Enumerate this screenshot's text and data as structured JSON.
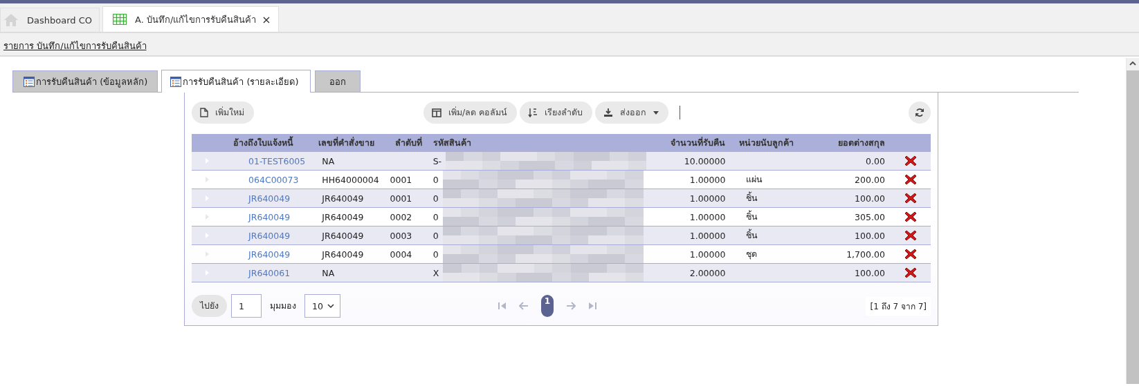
{
  "document_tabs": [
    {
      "label": "Dashboard CO",
      "selected": false,
      "kind": "home"
    },
    {
      "label": "A. บันทึก/แก้ไขการรับคืนสินค้า",
      "selected": true,
      "kind": "grid",
      "close": "×"
    }
  ],
  "breadcrumb": "รายการ บันทึก/แก้ไขการรับคืนสินค้า",
  "page_tabs": [
    {
      "label": "การรับคืนสินค้า (ข้อมูลหลัก)",
      "selected": false,
      "kind": "icon"
    },
    {
      "label": "การรับคืนสินค้า (รายละเอียด)",
      "selected": true,
      "kind": "icon"
    },
    {
      "label": "ออก",
      "selected": false,
      "kind": "plain"
    }
  ],
  "toolbar": {
    "add": "เพิ่มใหม่",
    "columns": "เพิ่ม/ลด คอลัมน์",
    "sort": "เรียงลำดับ",
    "export": "ส่งออก"
  },
  "table": {
    "columns": [
      "อ้างถึงใบแจ้งหนี้",
      "เลขที่คำสั่งขาย",
      "ลำดับที่",
      "รหัสสินค้า",
      "จำนวนที่รับคืน",
      "หน่วยนับลูกค้า",
      "ยอดต่างสกุล"
    ],
    "rows": [
      {
        "ref": "01-TEST6005",
        "order": "NA",
        "seq": "",
        "code": "S-",
        "qty": "10.00000",
        "unit": "",
        "amount": "0.00"
      },
      {
        "ref": "064C00073",
        "order": "HH64000004",
        "seq": "0001",
        "code": "0",
        "qty": "1.00000",
        "unit": "แผ่น",
        "amount": "200.00"
      },
      {
        "ref": "JR640049",
        "order": "JR640049",
        "seq": "0001",
        "code": "0",
        "qty": "1.00000",
        "unit": "ชิ้น",
        "amount": "100.00"
      },
      {
        "ref": "JR640049",
        "order": "JR640049",
        "seq": "0002",
        "code": "0",
        "qty": "1.00000",
        "unit": "ชิ้น",
        "amount": "305.00"
      },
      {
        "ref": "JR640049",
        "order": "JR640049",
        "seq": "0003",
        "code": "0",
        "qty": "1.00000",
        "unit": "ชิ้น",
        "amount": "100.00"
      },
      {
        "ref": "JR640049",
        "order": "JR640049",
        "seq": "0004",
        "code": "0",
        "qty": "1.00000",
        "unit": "ชุด",
        "amount": "1,700.00"
      },
      {
        "ref": "JR640061",
        "order": "NA",
        "seq": "",
        "code": "X",
        "qty": "2.00000",
        "unit": "",
        "amount": "100.00"
      }
    ]
  },
  "pager": {
    "goto": "ไปยัง",
    "page_value": "1",
    "view_label": "มุมมอง",
    "page_size": "10",
    "current_page": "1",
    "summary": "[1 ถึง 7 จาก 7]"
  }
}
